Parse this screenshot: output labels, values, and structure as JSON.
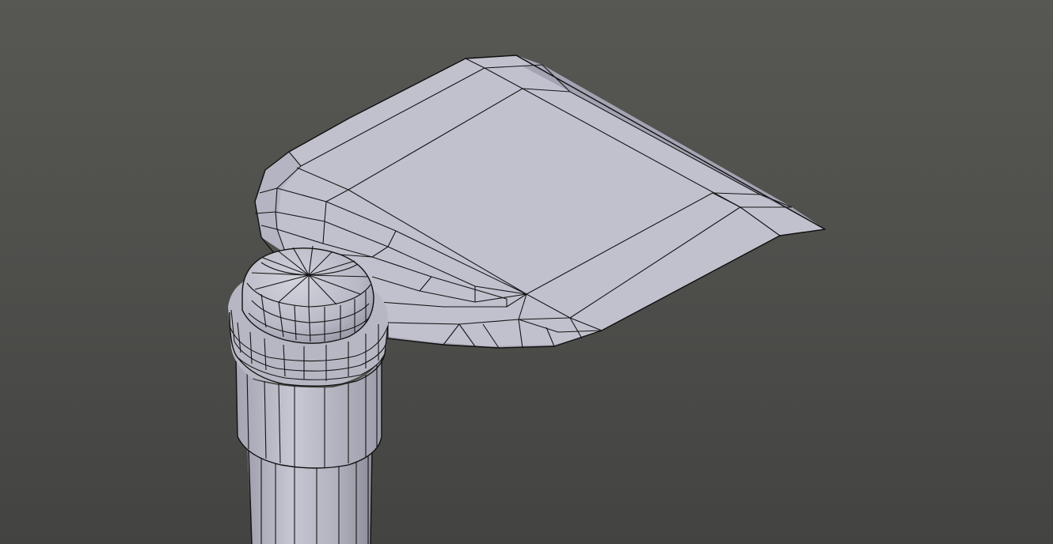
{
  "viewport": {
    "background_top": "#575753",
    "background_bottom": "#434342"
  },
  "mesh": {
    "face_color": "#bfbfcc",
    "face_shade": "#a7a7b6",
    "face_dark": "#8e8e9c",
    "wire_color": "#141414"
  }
}
